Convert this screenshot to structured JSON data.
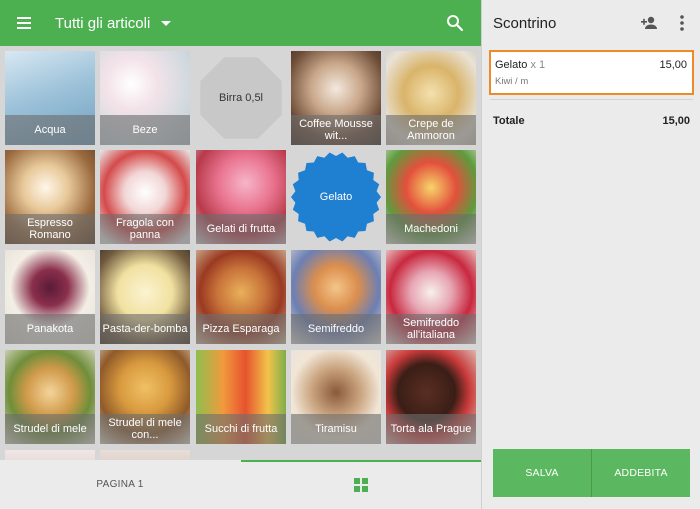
{
  "header": {
    "title": "Tutti gli articoli"
  },
  "tiles": [
    {
      "label": "Acqua",
      "style": "photo",
      "bg": "linear-gradient(160deg,#d8e8f2 0%,#9ec3da 45%,#6f9fbf 100%)"
    },
    {
      "label": "Beze",
      "style": "photo",
      "bg": "radial-gradient(circle at 35% 35%,#ffffff 0%,#f3e3e9 30%,#cfd9de 70%,#b9c6cc 100%)"
    },
    {
      "label": "Birra 0,5l",
      "style": "octagon",
      "color": "#c8c8c8"
    },
    {
      "label": "Coffee Mousse wit...",
      "style": "photo",
      "bg": "radial-gradient(circle at 50% 40%,#f3e9de 0%,#c9a78a 35%,#6b4a36 70%,#3a2a22 100%)"
    },
    {
      "label": "Crepe de Ammoron",
      "style": "photo",
      "bg": "radial-gradient(circle at 50% 45%,#f4e1ae 0%,#d9b46a 40%,#e9e2d6 75%,#cfc7bb 100%)"
    },
    {
      "label": "Espresso Romano",
      "style": "photo",
      "bg": "radial-gradient(circle at 45% 40%,#fff7ea 0%,#e8c99a 30%,#9a6a3e 65%,#5a3a22 100%)"
    },
    {
      "label": "Fragola con panna",
      "style": "photo",
      "bg": "radial-gradient(circle at 50% 45%,#ffffff 0%,#f2d6d6 30%,#d44a4a 60%,#e9e9e9 90%)"
    },
    {
      "label": "Gelati di frutta",
      "style": "photo",
      "bg": "radial-gradient(circle at 55% 35%,#f6b6c9 0%,#e9738f 35%,#b73a4a 65%,#d8d8d8 100%)"
    },
    {
      "label": "Gelato",
      "style": "seal",
      "color": "#1f7fd0"
    },
    {
      "label": "Machedoni",
      "style": "photo",
      "bg": "radial-gradient(circle at 50% 40%,#f7d46a 0%,#e3503c 35%,#5e9b3e 65%,#ece7df 100%)"
    },
    {
      "label": "Panakota",
      "style": "photo",
      "bg": "radial-gradient(circle at 50% 40%,#5a1b36 0%,#8a2f4c 25%,#f3efe6 55%,#e2ddd3 100%)"
    },
    {
      "label": "Pasta-der-bomba",
      "style": "photo",
      "bg": "radial-gradient(circle at 50% 45%,#fbf3d1 0%,#f1e1a0 40%,#6f5a3e 75%,#3e3328 100%)"
    },
    {
      "label": "Pizza Esparaga",
      "style": "photo",
      "bg": "radial-gradient(circle at 50% 45%,#e9b15a 0%,#c8733a 35%,#9a3a22 60%,#d7c5a6 100%)"
    },
    {
      "label": "Semifreddo",
      "style": "photo",
      "bg": "radial-gradient(circle at 50% 40%,#f3c58a 0%,#dc8f4e 30%,#6c7fb3 60%,#e8e4dc 100%)"
    },
    {
      "label": "Semifreddo all'italiana",
      "style": "photo",
      "bg": "radial-gradient(circle at 50% 45%,#f7f1ea 0%,#e7a6b4 30%,#c8283e 60%,#efe9e2 100%)"
    },
    {
      "label": "Strudel di mele",
      "style": "photo",
      "bg": "radial-gradient(circle at 50% 45%,#f4d49a 0%,#d09a4a 35%,#6f8e3a 60%,#e8e2d6 100%)"
    },
    {
      "label": "Strudel di mele con...",
      "style": "photo",
      "bg": "radial-gradient(circle at 50% 40%,#f0c065 0%,#d99a3e 35%,#8f5a2a 65%,#e4ded0 100%)"
    },
    {
      "label": "Succhi di frutta",
      "style": "photo",
      "bg": "linear-gradient(90deg,#8fbf4e 0%,#f19a3e 30%,#e6532e 55%,#f2c34a 80%,#7fae4a 100%)"
    },
    {
      "label": "Tiramisu",
      "style": "photo",
      "bg": "radial-gradient(circle at 50% 45%,#8a5a3a 0%,#c9a37e 35%,#f1e6d6 65%,#e8e3dc 100%)"
    },
    {
      "label": "Torta ala Prague",
      "style": "photo",
      "bg": "radial-gradient(circle at 45% 45%,#5a2e22 0%,#3a1e16 40%,#c83a3a 60%,#e2dbd2 100%)"
    },
    {
      "label": "",
      "style": "photo",
      "bg": "linear-gradient(180deg,#f0e6e6 0%,#e0d6d6 100%)"
    },
    {
      "label": "",
      "style": "photo",
      "bg": "linear-gradient(180deg,#e9ddd8 0%,#d8ccc6 100%)"
    }
  ],
  "footer": {
    "page_label": "PAGINA 1"
  },
  "receipt": {
    "title": "Scontrino",
    "item": {
      "name": "Gelato",
      "qty": "x 1",
      "price": "15,00",
      "variant": "Kiwi / m"
    },
    "total_label": "Totale",
    "total_value": "15,00",
    "save_label": "SALVA",
    "charge_label": "ADDEBITA"
  },
  "colors": {
    "primary": "#4caf50",
    "selected_border": "#ef8a2a",
    "gelato_badge": "#1f7fd0"
  },
  "icons": {
    "menu": "menu-icon",
    "dropdown": "caret-down-icon",
    "search": "search-icon",
    "grid": "grid-view-icon",
    "add_person": "add-person-icon",
    "more": "more-vert-icon"
  }
}
